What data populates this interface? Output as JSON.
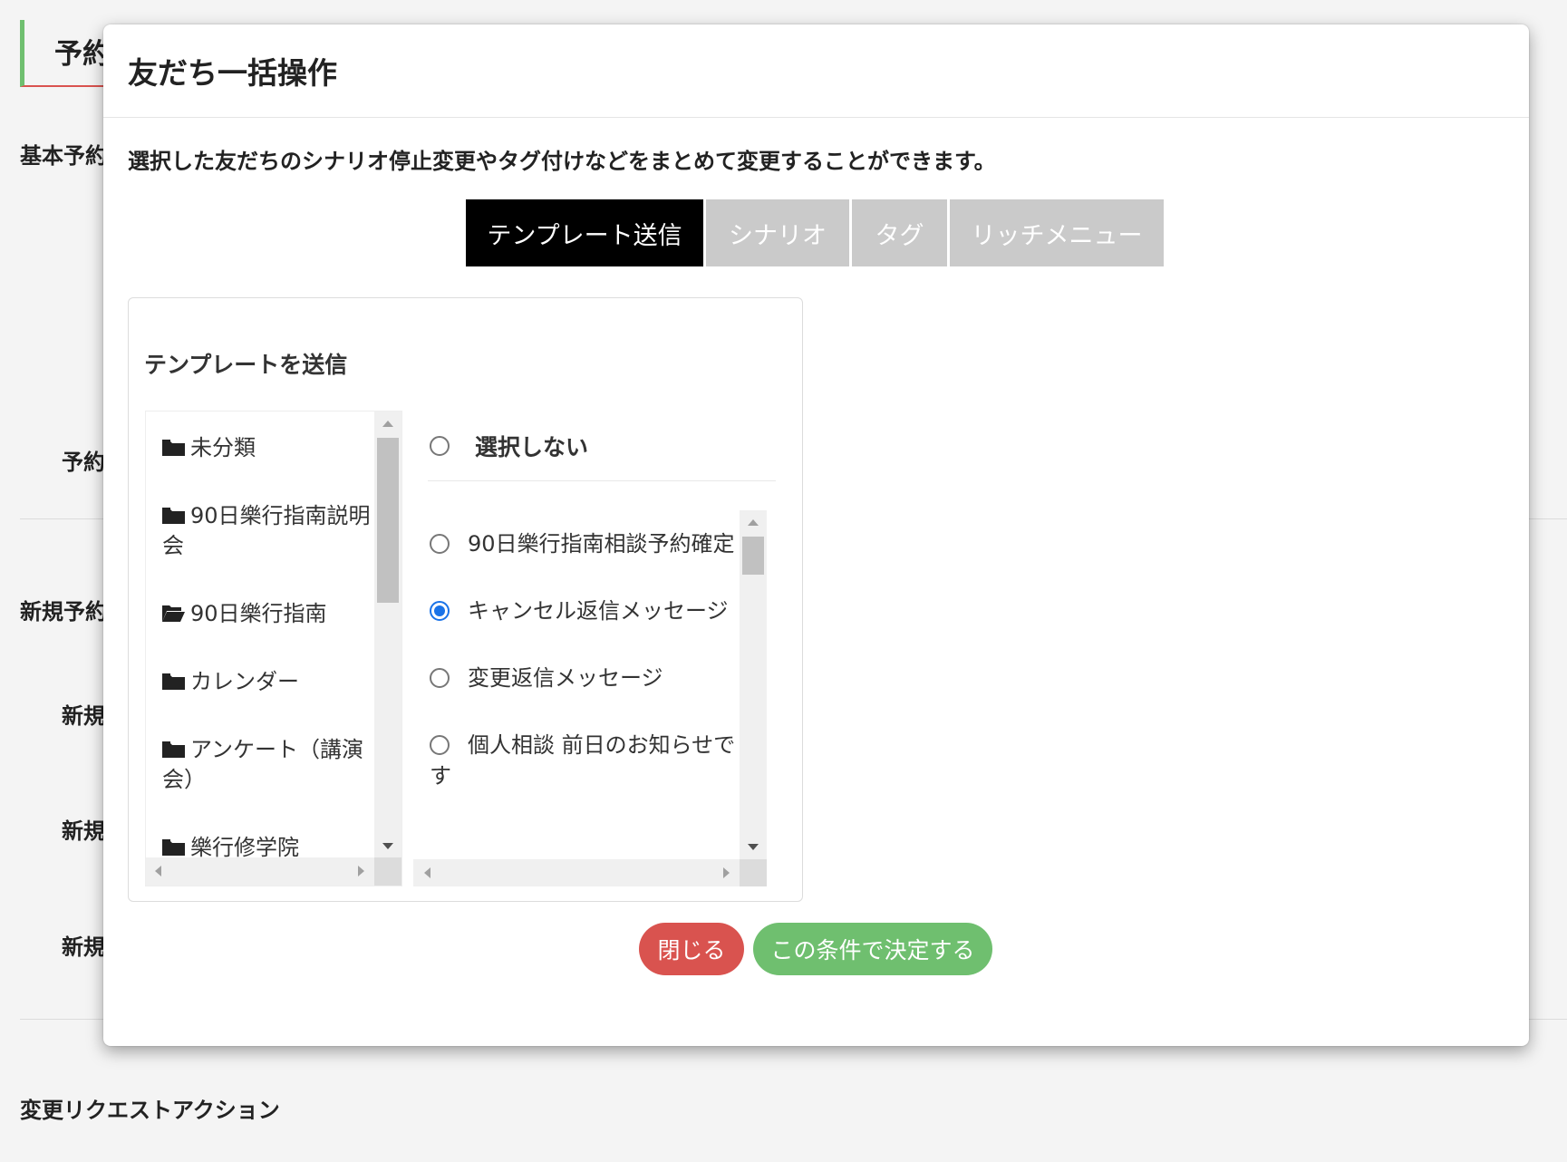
{
  "background": {
    "heading": "予約",
    "labels": [
      "基本予約",
      "予約",
      "新規予約",
      "新規",
      "新規",
      "新規"
    ],
    "section_title": "変更リクエストアクション"
  },
  "modal": {
    "title": "友だち一括操作",
    "description": "選択した友だちのシナリオ停止変更やタグ付けなどをまとめて変更することができます。",
    "tabs": [
      "テンプレート送信",
      "シナリオ",
      "タグ",
      "リッチメニュー"
    ],
    "active_tab": "テンプレート送信",
    "panel_title": "テンプレートを送信",
    "folders": [
      {
        "label": "未分類",
        "icon": "folder-icon"
      },
      {
        "label": "90日樂行指南説明会",
        "icon": "folder-icon"
      },
      {
        "label": "90日樂行指南",
        "icon": "folder-open-icon"
      },
      {
        "label": "カレンダー",
        "icon": "folder-icon"
      },
      {
        "label": "アンケート（講演会）",
        "icon": "folder-icon"
      },
      {
        "label": "樂行修学院",
        "icon": "folder-icon"
      }
    ],
    "none_option": "選択しない",
    "templates": [
      {
        "label": "90日樂行指南相談予約確定",
        "checked": false
      },
      {
        "label": "キャンセル返信メッセージ",
        "checked": true
      },
      {
        "label": "変更返信メッセージ",
        "checked": false
      },
      {
        "label": "個人相談 前日のお知らせです",
        "checked": false
      }
    ],
    "buttons": {
      "close": "閉じる",
      "confirm": "この条件で決定する"
    }
  },
  "colors": {
    "tab_active": "#000000",
    "tab_inactive": "#cacaca",
    "close_button": "#d9534f",
    "confirm_button": "#6fbf6f",
    "radio_checked": "#1a73e8"
  }
}
